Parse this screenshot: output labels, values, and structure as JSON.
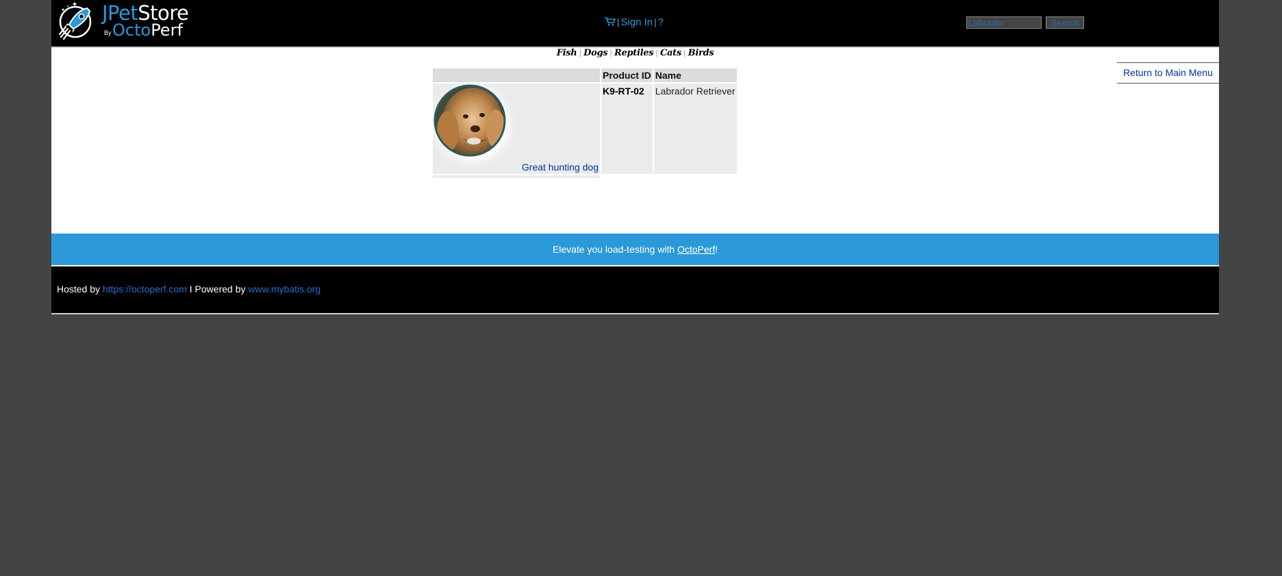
{
  "header": {
    "logo": {
      "part1": "JPet",
      "part2": "Store",
      "by": "By",
      "brand1": "Octo",
      "brand2": "Perf"
    },
    "menu": {
      "signin_label": "Sign In",
      "help_label": "?",
      "separator": "|"
    },
    "search": {
      "placeholder": "Labrador",
      "button_label": "Search"
    }
  },
  "quicklinks": [
    "Fish",
    "Dogs",
    "Reptiles",
    "Cats",
    "Birds"
  ],
  "back_link": "Return to Main Menu",
  "product_table": {
    "columns": [
      "",
      "Product ID",
      "Name"
    ],
    "rows": [
      {
        "image_icon": "labrador-photo",
        "description": "Great hunting dog",
        "product_id": "K9-RT-02",
        "name": "Labrador Retriever"
      }
    ]
  },
  "promo": {
    "text_before": "Elevate you load-testing with ",
    "link": "OctoPerf",
    "text_after": "!"
  },
  "footer": {
    "hosted_label": "Hosted by ",
    "hosted_link": "https://octoperf.com",
    "powered_label": " I Powered by ",
    "powered_link": "www.mybatis.org"
  },
  "colors": {
    "page_bg": "#444444",
    "header_bg": "#000000",
    "accent_blue": "#2b99d8",
    "link_blue": "#003399",
    "table_header_bg": "#dcdcdc",
    "table_cell_bg": "#ebebeb"
  }
}
